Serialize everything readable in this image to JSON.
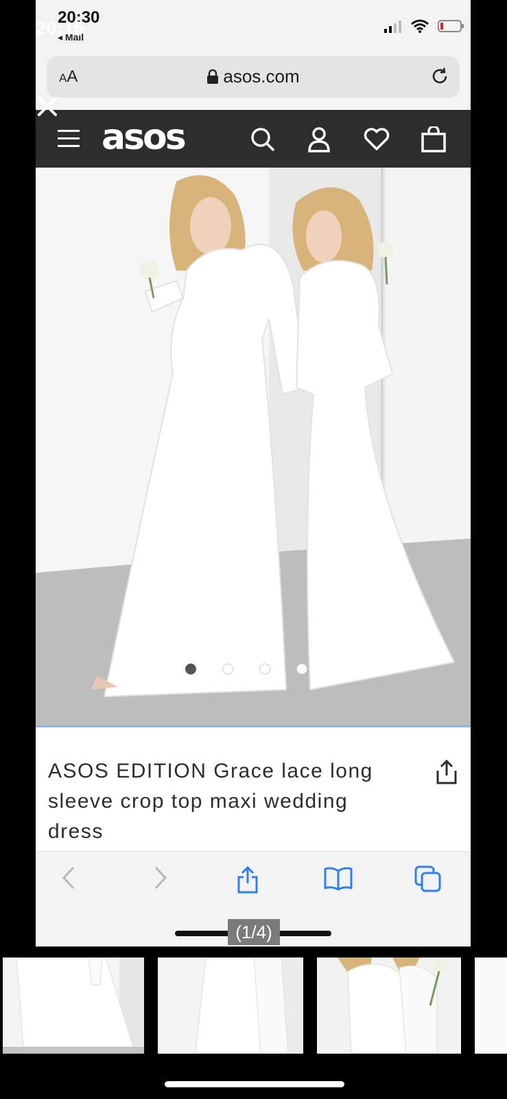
{
  "viewer": {
    "time": "20:15",
    "counter": "(1/4)"
  },
  "status_bar": {
    "time": "20:30",
    "back_label": "◂ Mail"
  },
  "browser": {
    "text_size_label_small": "A",
    "text_size_label_large": "A",
    "url": "asos.com"
  },
  "site": {
    "logo": "asos"
  },
  "gallery": {
    "dot_count": 4,
    "active_index": 0
  },
  "product": {
    "title": "ASOS EDITION Grace lace long sleeve crop top maxi wedding dress"
  },
  "colors": {
    "header_bg": "#2d2d2d",
    "accent_blue": "#2f7ff2",
    "divider_blue": "#8fb3e6"
  },
  "icons": {
    "header": [
      "hamburger-icon",
      "search-icon",
      "account-icon",
      "heart-icon",
      "bag-icon"
    ],
    "toolbar": [
      "back-icon",
      "forward-icon",
      "share-icon",
      "bookmarks-icon",
      "tabs-icon"
    ]
  }
}
